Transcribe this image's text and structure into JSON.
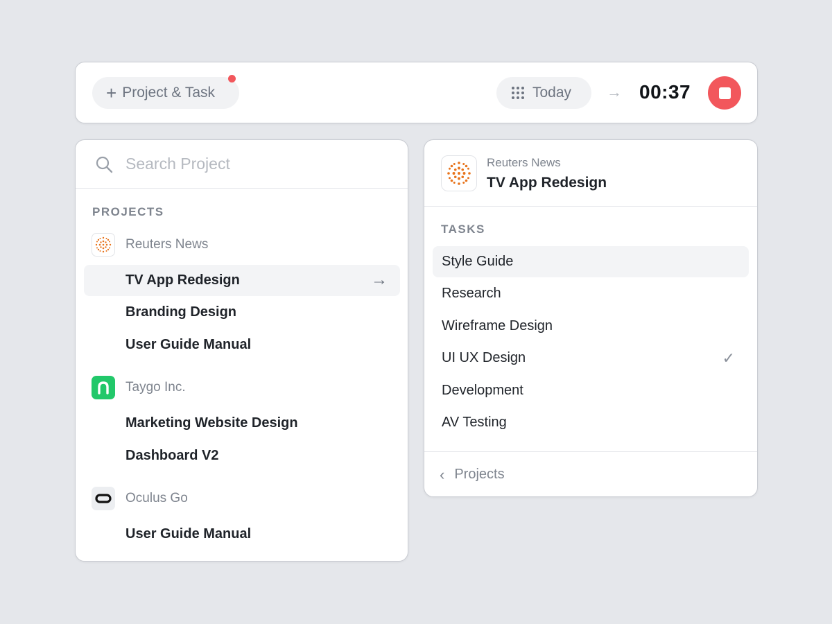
{
  "topbar": {
    "project_task_label": "Project & Task",
    "today_label": "Today",
    "timer": "00:37",
    "stop_color": "#f2575c"
  },
  "search": {
    "placeholder": "Search Project"
  },
  "projects_panel": {
    "section_title": "PROJECTS",
    "groups": [
      {
        "client": "Reuters News",
        "logo_icon": "reuters-logo",
        "items": [
          "TV App Redesign",
          "Branding Design",
          "User Guide Manual"
        ],
        "active_item": "TV App Redesign"
      },
      {
        "client": "Taygo Inc.",
        "logo_icon": "taygo-logo",
        "logo_color": "#22c86a",
        "items": [
          "Marketing Website Design",
          "Dashboard V2"
        ]
      },
      {
        "client": "Oculus Go",
        "logo_icon": "oculus-logo",
        "items": [
          "User Guide Manual"
        ]
      }
    ]
  },
  "tasks_panel": {
    "client": "Reuters News",
    "project": "TV App Redesign",
    "section_title": "TASKS",
    "tasks": [
      "Style Guide",
      "Research",
      "Wireframe Design",
      "UI UX Design",
      "Development",
      "AV Testing"
    ],
    "active_task": "Style Guide",
    "checked_task": "UI UX Design",
    "back_label": "Projects"
  }
}
